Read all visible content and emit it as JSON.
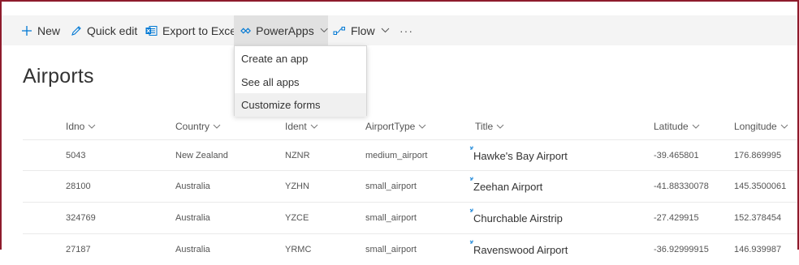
{
  "toolbar": {
    "new_label": "New",
    "quick_edit_label": "Quick edit",
    "export_label": "Export to Excel",
    "powerapps_label": "PowerApps",
    "flow_label": "Flow",
    "more_label": "···"
  },
  "powerapps_menu": {
    "items": [
      "Create an app",
      "See all apps",
      "Customize forms"
    ]
  },
  "page": {
    "title": "Airports"
  },
  "table": {
    "columns": [
      "Idno",
      "Country",
      "Ident",
      "AirportType",
      "Title",
      "Latitude",
      "Longitude"
    ],
    "rows": [
      {
        "idno": "5043",
        "country": "New Zealand",
        "ident": "NZNR",
        "type": "medium_airport",
        "title": "Hawke's Bay Airport",
        "lat": "-39.465801",
        "lon": "176.869995"
      },
      {
        "idno": "28100",
        "country": "Australia",
        "ident": "YZHN",
        "type": "small_airport",
        "title": "Zeehan Airport",
        "lat": "-41.88330078",
        "lon": "145.3500061"
      },
      {
        "idno": "324769",
        "country": "Australia",
        "ident": "YZCE",
        "type": "small_airport",
        "title": "Churchable Airstrip",
        "lat": "-27.429915",
        "lon": "152.378454"
      },
      {
        "idno": "27187",
        "country": "Australia",
        "ident": "YRMC",
        "type": "small_airport",
        "title": "Ravenswood Airport",
        "lat": "-36.92999915",
        "lon": "146.939987"
      }
    ]
  },
  "colors": {
    "accent": "#0078d4",
    "frame": "#8e1b2c",
    "new_item_marker": "#0078d4"
  }
}
